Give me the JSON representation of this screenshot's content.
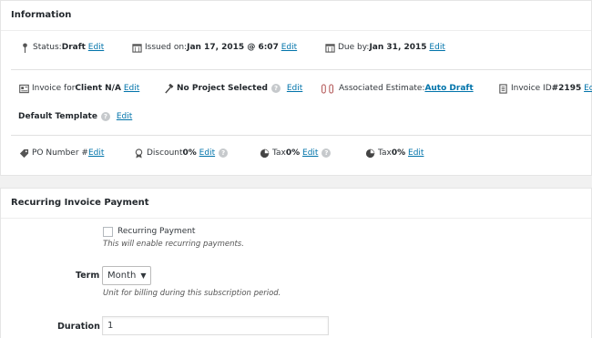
{
  "info": {
    "title": "Information",
    "status_label": "Status: ",
    "status_value": "Draft",
    "issued_label": "Issued on: ",
    "issued_value": "Jan 17, 2015 @ 6:07",
    "due_label": "Due by: ",
    "due_value": "Jan 31, 2015",
    "edit": "Edit",
    "client_label": "Invoice for ",
    "client_value": "Client N/A",
    "project_value": "No Project Selected",
    "estimate_label": "Associated Estimate: ",
    "estimate_link": "Auto Draft",
    "invoice_id_label": "Invoice ID ",
    "invoice_id_value": "#2195",
    "template_value": "Default Template",
    "po_label": "PO Number # ",
    "discount_label": "Discount ",
    "discount_value": "0%",
    "tax_label": "Tax ",
    "tax1_value": "0%",
    "tax2_value": "0%",
    "help": "?"
  },
  "recurring": {
    "title": "Recurring Invoice Payment",
    "checkbox_label": "Recurring Payment",
    "checkbox_hint": "This will enable recurring payments.",
    "term_label": "Term",
    "term_value": "Month",
    "term_hint": "Unit for billing during this subscription period.",
    "duration_label": "Duration",
    "duration_value": "1"
  }
}
